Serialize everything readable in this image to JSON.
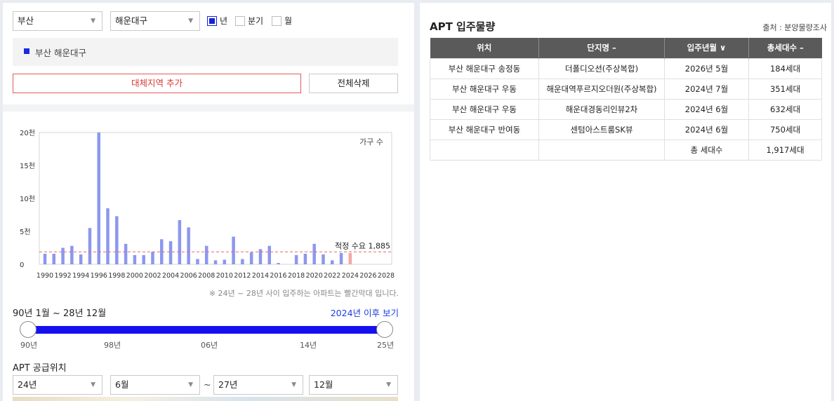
{
  "filters": {
    "region": "부산",
    "district": "해운대구",
    "period_options": [
      {
        "label": "년",
        "checked": true
      },
      {
        "label": "분기",
        "checked": false
      },
      {
        "label": "월",
        "checked": false
      }
    ]
  },
  "selected_region": "부산 해운대구",
  "buttons": {
    "add_region": "대체지역 추가",
    "delete_all": "전체삭제"
  },
  "chart_data": {
    "type": "bar",
    "legend": "가구 수",
    "y_ticks": [
      "0",
      "5천",
      "10천",
      "15천",
      "20천"
    ],
    "ylim": [
      0,
      20000
    ],
    "x_tick_labels": [
      "1990",
      "1992",
      "1994",
      "1996",
      "1998",
      "2000",
      "2002",
      "2004",
      "2006",
      "2008",
      "2010",
      "2012",
      "2014",
      "2016",
      "2018",
      "2020",
      "2022",
      "2024",
      "2026",
      "2028"
    ],
    "x": [
      1990,
      1991,
      1992,
      1993,
      1994,
      1995,
      1996,
      1997,
      1998,
      1999,
      2000,
      2001,
      2002,
      2003,
      2004,
      2005,
      2006,
      2007,
      2008,
      2009,
      2010,
      2011,
      2012,
      2013,
      2014,
      2015,
      2016,
      2017,
      2018,
      2019,
      2020,
      2021,
      2022,
      2023,
      2024,
      2025,
      2026,
      2027,
      2028
    ],
    "values": [
      1600,
      1600,
      2500,
      2800,
      1500,
      5500,
      20000,
      8500,
      7300,
      3100,
      1400,
      1400,
      1900,
      3800,
      3500,
      6700,
      5600,
      800,
      2800,
      600,
      700,
      4200,
      800,
      1800,
      2300,
      2800,
      200,
      0,
      1400,
      1600,
      3100,
      1500,
      600,
      1700,
      1700,
      0,
      0,
      0,
      0
    ],
    "highlight_from": 2024,
    "bar_color": "#8c97ef",
    "highlight_color": "#f6a6a6",
    "reference_line": {
      "label": "적정 수요 1,885",
      "value": 1885,
      "color": "#e06a6a"
    }
  },
  "chart_note": "※ 24년 ~ 28년 사이 입주하는 아파트는 빨간막대 입니다.",
  "range": {
    "label": "90년 1월 ~ 28년 12월",
    "after_link": "2024년 이후 보기",
    "ticks": [
      "90년",
      "98년",
      "06년",
      "14년",
      "25년"
    ]
  },
  "supply": {
    "title": "APT 공급위치",
    "from_year": "24년",
    "from_month": "6월",
    "tilde": "~",
    "to_year": "27년",
    "to_month": "12월"
  },
  "right": {
    "title": "APT 입주물량",
    "source": "출처 : 분양물량조사",
    "columns": [
      "위치",
      "단지명 –",
      "입주년월 ∨",
      "총세대수 –"
    ],
    "rows": [
      [
        "부산 해운대구 송정동",
        "더폴디오션(주상복합)",
        "2026년 5월",
        "184세대"
      ],
      [
        "부산 해운대구 우동",
        "해운대역푸르지오더원(주상복합)",
        "2024년 7월",
        "351세대"
      ],
      [
        "부산 해운대구 우동",
        "해운대경동리인뷰2차",
        "2024년 6월",
        "632세대"
      ],
      [
        "부산 해운대구 반여동",
        "센텀아스트룸SK뷰",
        "2024년 6월",
        "750세대"
      ],
      [
        "",
        "",
        "총 세대수",
        "1,917세대"
      ]
    ]
  }
}
